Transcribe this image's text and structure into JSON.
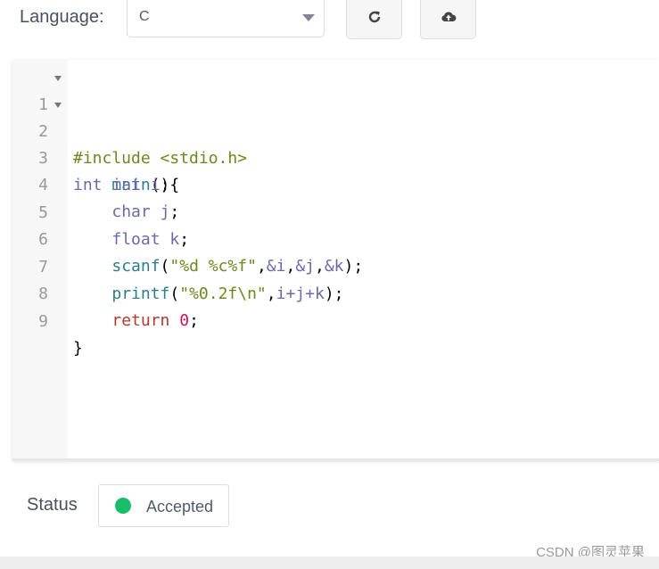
{
  "toolbar": {
    "language_label": "Language:",
    "language_value": "C",
    "reset_icon": "refresh-icon",
    "upload_icon": "cloud-upload-icon"
  },
  "editor": {
    "lines": [
      {
        "number": "1",
        "foldable": true
      },
      {
        "number": "2",
        "foldable": true
      },
      {
        "number": "3",
        "foldable": false
      },
      {
        "number": "4",
        "foldable": false
      },
      {
        "number": "5",
        "foldable": false
      },
      {
        "number": "6",
        "foldable": false
      },
      {
        "number": "7",
        "foldable": false
      },
      {
        "number": "8",
        "foldable": false
      },
      {
        "number": "9",
        "foldable": false
      }
    ],
    "code": {
      "l1": {
        "directive": "#include <stdio.h>"
      },
      "l2": {
        "type": "int",
        "space": " ",
        "fn": "main",
        "rest": "(){"
      },
      "l3": {
        "indent": "    ",
        "type": "int",
        "space": " ",
        "var": "i",
        "semi": ";"
      },
      "l4": {
        "indent": "    ",
        "type": "char",
        "space": " ",
        "var": "j",
        "semi": ";"
      },
      "l5": {
        "indent": "    ",
        "type": "float",
        "space": " ",
        "var": "k",
        "semi": ";"
      },
      "l6": {
        "indent": "    ",
        "fn": "scanf",
        "open": "(",
        "str": "\"%d %c%f\"",
        "c1": ",",
        "a1": "&i",
        "c2": ",",
        "a2": "&j",
        "c3": ",",
        "a3": "&k",
        "close": ");"
      },
      "l7": {
        "indent": "    ",
        "fn": "printf",
        "open": "(",
        "str": "\"%0.2f\\n\"",
        "c1": ",",
        "expr": "i+j+k",
        "close": ");"
      },
      "l8": {
        "indent": "    ",
        "kw": "return",
        "space": " ",
        "num": "0",
        "semi": ";"
      },
      "l9": {
        "brace": "}"
      }
    }
  },
  "status": {
    "label": "Status",
    "value": "Accepted",
    "color": "#19be6b"
  },
  "watermark": "CSDN @图灵苹果",
  "colors": {
    "accepted": "#19be6b",
    "keyword": "#6a6aab",
    "string": "#6a8a1f",
    "return": "#b03a2e",
    "number": "#c2185b"
  }
}
